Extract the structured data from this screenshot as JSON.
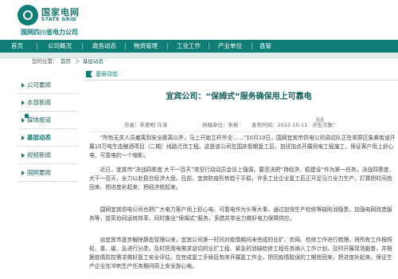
{
  "header": {
    "logo_cn": "国家电网",
    "logo_en": "STATE GRID",
    "org_name": "国网四川省电力公司"
  },
  "nav": {
    "items": [
      "首页",
      "公司概况",
      "政务动态",
      "物资管理",
      "工业工作",
      "产业单位",
      "县管"
    ]
  },
  "subnav": {
    "items": [
      "首页",
      "数字旗",
      "党建",
      "工会工作"
    ]
  },
  "breadcrumb": {
    "prefix": "您的位置：",
    "home": "首页",
    "sep": "＞",
    "current": "基层动态"
  },
  "sidebar": {
    "items": [
      {
        "label": "公司要闻"
      },
      {
        "label": "本部新闻"
      },
      {
        "label": "媒体报道"
      },
      {
        "label": "基层动态"
      },
      {
        "label": "视频新闻"
      },
      {
        "label": "国网要闻"
      }
    ]
  },
  "article": {
    "section": "基层动态",
    "title": "宜宾公司：“保姆式”服务确保用上可靠电",
    "author": "作者：朱君明 许涛",
    "source": "供稿单位：朱彬",
    "date": "发布时间：2022-10-11",
    "views_label": "点击次数：",
    "views": "66",
    "paragraphs": [
      "“所有无关人员撤离到安全距离以外，马上开始立杆作业……”10月10日，国网宜宾市供电公司调试队正在翠屏区象鼻街道开展10万吨生态酿酒项目（二期）线路迁改工程。这是该公司在国庆假期复工后，加班加点开展用电工程施工，保证客户用上舒心电、可靠电的一个缩影。",
      "近日，宜宾市“决战四季度 大干一百天”攻坚行动动员会议上强调，要坚决把“持经济、稳建设”作为第一任务，决战四季度、大干一百天，全力以赴稳住经济大盘。目前，宜宾防疫形势趋于平稳，许多工业企业复工后正开足马力全力生产，打算把时间抢回来、把进度补起来、把经济抢起来。",
      "国网宜宾供电公司也把广大电力客户用上舒心电、可靠电作为头等大事，通过加快生产检修等缺陷消隐患，加强电网改造服务等，提高协同运转效率，同时推出“保姆式”服务，多措并举全力做好电力保障供应。",
      "自宜宾市逐步解除静态管理以来，宜宾公司第一时间对疫情期间未完成的业扩、农网、检修工作进行梳理，将所有工作按照轻、重、缓、急进行分类，及时把用电需求迫切的业扩工程、紧急的消缺检修工程任务纳入工作计划，及时开展现场勘查，并根据疫情防控需求做好复工安全评估。在完成复工手续后有序开展复工作业，把因疫情耽误的工期抢回来，把进度补起来，保证生产企业在冲刺生产任务期间用上安全放心电。"
    ]
  }
}
